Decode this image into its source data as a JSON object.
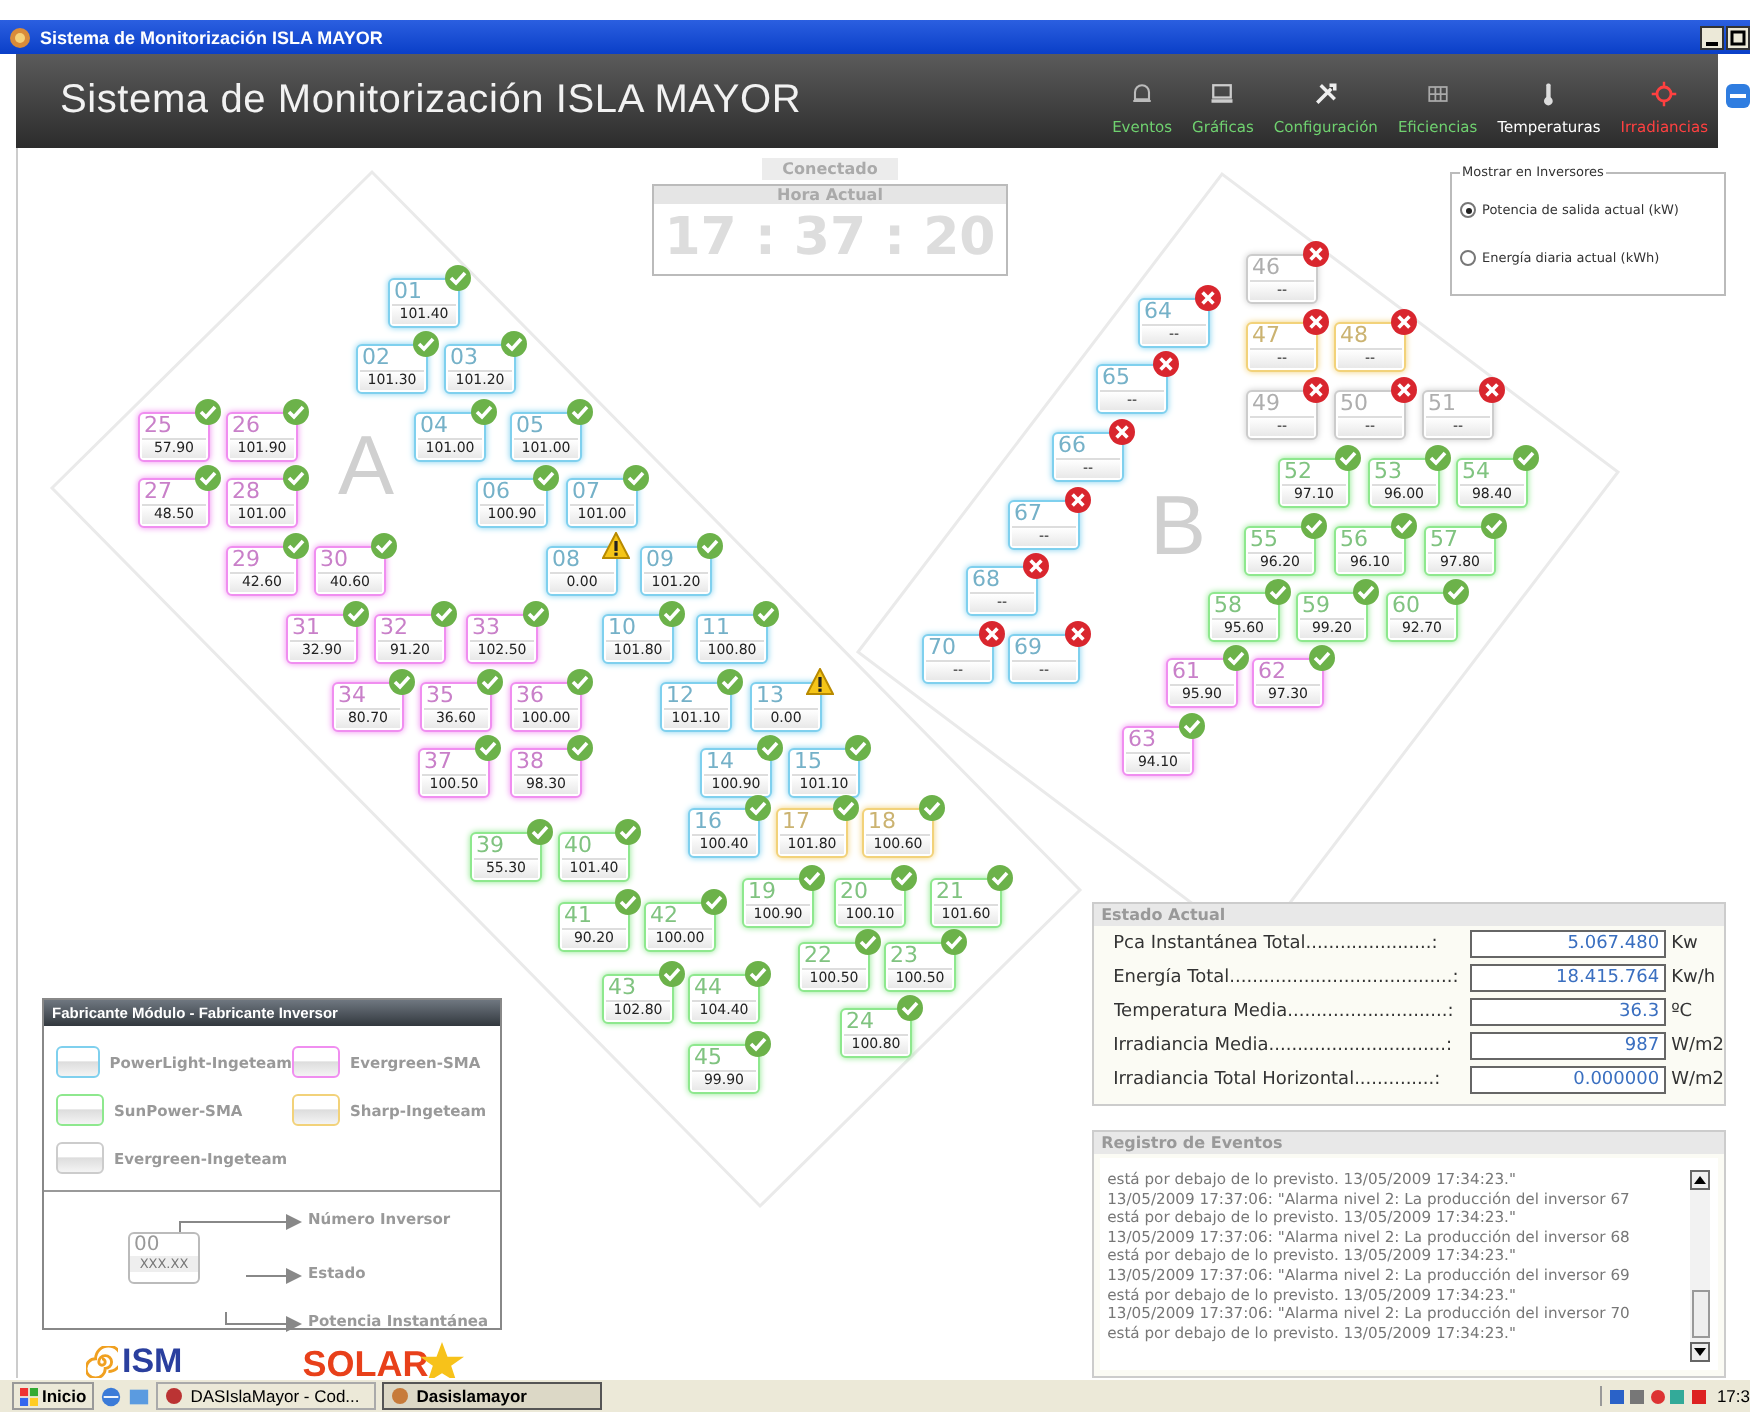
{
  "window": {
    "title": "Sistema de Monitorización ISLA MAYOR"
  },
  "header": {
    "title": "Sistema de Monitorización ISLA MAYOR",
    "nav": [
      {
        "label": "Eventos"
      },
      {
        "label": "Gráficas"
      },
      {
        "label": "Configuración"
      },
      {
        "label": "Eficiencias"
      },
      {
        "label": "Temperaturas"
      },
      {
        "label": "Irradiancias"
      }
    ]
  },
  "connection": {
    "status": "Conectado",
    "clock_label": "Hora Actual",
    "time": "17 : 37 : 20"
  },
  "display_options": {
    "title": "Mostrar en Inversores",
    "options": [
      {
        "label": "Potencia de salida actual (kW)",
        "selected": true
      },
      {
        "label": "Energía diaria actual (kWh)",
        "selected": false
      }
    ]
  },
  "areas": [
    {
      "label": "A"
    },
    {
      "label": "B"
    }
  ],
  "inverters": [
    {
      "number": "46",
      "value": "--",
      "color": "#cccccc",
      "kind": "error"
    },
    {
      "number": "01",
      "value": "101.40",
      "color": "#7fd0ee",
      "kind": "ok"
    },
    {
      "number": "64",
      "value": "--",
      "color": "#7fd0ee",
      "kind": "error"
    },
    {
      "number": "47",
      "value": "--",
      "color": "#f2d27a",
      "kind": "error"
    },
    {
      "number": "48",
      "value": "--",
      "color": "#f2d27a",
      "kind": "error"
    },
    {
      "number": "02",
      "value": "101.30",
      "color": "#7fd0ee",
      "kind": "ok"
    },
    {
      "number": "03",
      "value": "101.20",
      "color": "#7fd0ee",
      "kind": "ok"
    },
    {
      "number": "65",
      "value": "--",
      "color": "#7fd0ee",
      "kind": "error"
    },
    {
      "number": "49",
      "value": "--",
      "color": "#cccccc",
      "kind": "error"
    },
    {
      "number": "50",
      "value": "--",
      "color": "#cccccc",
      "kind": "error"
    },
    {
      "number": "51",
      "value": "--",
      "color": "#cccccc",
      "kind": "error"
    },
    {
      "number": "25",
      "value": "57.90",
      "color": "#f08ef0",
      "kind": "ok"
    },
    {
      "number": "26",
      "value": "101.90",
      "color": "#f08ef0",
      "kind": "ok"
    },
    {
      "number": "04",
      "value": "101.00",
      "color": "#7fd0ee",
      "kind": "ok"
    },
    {
      "number": "05",
      "value": "101.00",
      "color": "#7fd0ee",
      "kind": "ok"
    },
    {
      "number": "66",
      "value": "--",
      "color": "#7fd0ee",
      "kind": "error"
    },
    {
      "number": "52",
      "value": "97.10",
      "color": "#8ee88e",
      "kind": "ok"
    },
    {
      "number": "53",
      "value": "96.00",
      "color": "#8ee88e",
      "kind": "ok"
    },
    {
      "number": "54",
      "value": "98.40",
      "color": "#8ee88e",
      "kind": "ok"
    },
    {
      "number": "27",
      "value": "48.50",
      "color": "#f08ef0",
      "kind": "ok"
    },
    {
      "number": "28",
      "value": "101.00",
      "color": "#f08ef0",
      "kind": "ok"
    },
    {
      "number": "06",
      "value": "100.90",
      "color": "#7fd0ee",
      "kind": "ok"
    },
    {
      "number": "07",
      "value": "101.00",
      "color": "#7fd0ee",
      "kind": "ok"
    },
    {
      "number": "67",
      "value": "--",
      "color": "#7fd0ee",
      "kind": "error"
    },
    {
      "number": "55",
      "value": "96.20",
      "color": "#8ee88e",
      "kind": "ok"
    },
    {
      "number": "56",
      "value": "96.10",
      "color": "#8ee88e",
      "kind": "ok"
    },
    {
      "number": "57",
      "value": "97.80",
      "color": "#8ee88e",
      "kind": "ok"
    },
    {
      "number": "29",
      "value": "42.60",
      "color": "#f08ef0",
      "kind": "ok"
    },
    {
      "number": "30",
      "value": "40.60",
      "color": "#f08ef0",
      "kind": "ok"
    },
    {
      "number": "08",
      "value": "0.00",
      "color": "#7fd0ee",
      "kind": "warning"
    },
    {
      "number": "09",
      "value": "101.20",
      "color": "#7fd0ee",
      "kind": "ok"
    },
    {
      "number": "68",
      "value": "--",
      "color": "#7fd0ee",
      "kind": "error"
    },
    {
      "number": "58",
      "value": "95.60",
      "color": "#8ee88e",
      "kind": "ok"
    },
    {
      "number": "59",
      "value": "99.20",
      "color": "#8ee88e",
      "kind": "ok"
    },
    {
      "number": "60",
      "value": "92.70",
      "color": "#8ee88e",
      "kind": "ok"
    },
    {
      "number": "31",
      "value": "32.90",
      "color": "#f08ef0",
      "kind": "ok"
    },
    {
      "number": "32",
      "value": "91.20",
      "color": "#f08ef0",
      "kind": "ok"
    },
    {
      "number": "33",
      "value": "102.50",
      "color": "#f08ef0",
      "kind": "ok"
    },
    {
      "number": "10",
      "value": "101.80",
      "color": "#7fd0ee",
      "kind": "ok"
    },
    {
      "number": "11",
      "value": "100.80",
      "color": "#7fd0ee",
      "kind": "ok"
    },
    {
      "number": "70",
      "value": "--",
      "color": "#7fd0ee",
      "kind": "error"
    },
    {
      "number": "69",
      "value": "--",
      "color": "#7fd0ee",
      "kind": "error"
    },
    {
      "number": "61",
      "value": "95.90",
      "color": "#f08ef0",
      "kind": "ok"
    },
    {
      "number": "62",
      "value": "97.30",
      "color": "#f08ef0",
      "kind": "ok"
    },
    {
      "number": "34",
      "value": "80.70",
      "color": "#f08ef0",
      "kind": "ok"
    },
    {
      "number": "35",
      "value": "36.60",
      "color": "#f08ef0",
      "kind": "ok"
    },
    {
      "number": "36",
      "value": "100.00",
      "color": "#f08ef0",
      "kind": "ok"
    },
    {
      "number": "12",
      "value": "101.10",
      "color": "#7fd0ee",
      "kind": "ok"
    },
    {
      "number": "13",
      "value": "0.00",
      "color": "#7fd0ee",
      "kind": "warning"
    },
    {
      "number": "63",
      "value": "94.10",
      "color": "#f08ef0",
      "kind": "ok"
    },
    {
      "number": "37",
      "value": "100.50",
      "color": "#f08ef0",
      "kind": "ok"
    },
    {
      "number": "38",
      "value": "98.30",
      "color": "#f08ef0",
      "kind": "ok"
    },
    {
      "number": "14",
      "value": "100.90",
      "color": "#7fd0ee",
      "kind": "ok"
    },
    {
      "number": "15",
      "value": "101.10",
      "color": "#7fd0ee",
      "kind": "ok"
    },
    {
      "number": "16",
      "value": "100.40",
      "color": "#7fd0ee",
      "kind": "ok"
    },
    {
      "number": "17",
      "value": "101.80",
      "color": "#f2d27a",
      "kind": "ok"
    },
    {
      "number": "18",
      "value": "100.60",
      "color": "#f2d27a",
      "kind": "ok"
    },
    {
      "number": "39",
      "value": "55.30",
      "color": "#8ee88e",
      "kind": "ok"
    },
    {
      "number": "40",
      "value": "101.40",
      "color": "#8ee88e",
      "kind": "ok"
    },
    {
      "number": "19",
      "value": "100.90",
      "color": "#8ee88e",
      "kind": "ok"
    },
    {
      "number": "20",
      "value": "100.10",
      "color": "#8ee88e",
      "kind": "ok"
    },
    {
      "number": "21",
      "value": "101.60",
      "color": "#8ee88e",
      "kind": "ok"
    },
    {
      "number": "41",
      "value": "90.20",
      "color": "#8ee88e",
      "kind": "ok"
    },
    {
      "number": "42",
      "value": "100.00",
      "color": "#8ee88e",
      "kind": "ok"
    },
    {
      "number": "22",
      "value": "100.50",
      "color": "#8ee88e",
      "kind": "ok"
    },
    {
      "number": "23",
      "value": "100.50",
      "color": "#8ee88e",
      "kind": "ok"
    },
    {
      "number": "43",
      "value": "102.80",
      "color": "#8ee88e",
      "kind": "ok"
    },
    {
      "number": "44",
      "value": "104.40",
      "color": "#8ee88e",
      "kind": "ok"
    },
    {
      "number": "24",
      "value": "100.80",
      "color": "#8ee88e",
      "kind": "ok"
    },
    {
      "number": "45",
      "value": "99.90",
      "color": "#8ee88e",
      "kind": "ok"
    }
  ],
  "legend": {
    "title": "Fabricante Módulo - Fabricante Inversor",
    "manufacturers": [
      {
        "label": "PowerLight-Ingeteam",
        "color": "#7fd0ee"
      },
      {
        "label": "Evergreen-SMA",
        "color": "#f08ef0"
      },
      {
        "label": "SunPower-SMA",
        "color": "#8ee88e"
      },
      {
        "label": "Sharp-Ingeteam",
        "color": "#f2d27a"
      },
      {
        "label": "Evergreen-Ingeteam",
        "color": "#cccccc"
      }
    ],
    "key": {
      "number": "00",
      "value": "XXX.XX",
      "labels": [
        "Número Inversor",
        "Estado",
        "Potencia Instantánea"
      ]
    }
  },
  "logos": [
    "ISM",
    "SOLAR"
  ],
  "current_state": {
    "title": "Estado Actual",
    "rows": [
      {
        "label": "Pca Instantánea Total......................:",
        "value": "5.067.480",
        "unit": "Kw"
      },
      {
        "label": "Energía Total.......................................:",
        "value": "18.415.764",
        "unit": "Kw/h"
      },
      {
        "label": "Temperatura Media............................:",
        "value": "36.3",
        "unit": "ºC"
      },
      {
        "label": "Irradiancia Media...............................:",
        "value": "987",
        "unit": "W/m2"
      },
      {
        "label": "Irradiancia Total Horizontal..............:",
        "value": "0.000000",
        "unit": "W/m2"
      }
    ]
  },
  "event_log": {
    "title": "Registro de Eventos",
    "lines": [
      "está por debajo de lo previsto. 13/05/2009 17:34:23.\"",
      "13/05/2009 17:37:06: \"Alarma nivel 2: La producción del inversor 67",
      "está por debajo de lo previsto. 13/05/2009 17:34:23.\"",
      "13/05/2009 17:37:06: \"Alarma nivel 2: La producción del inversor 68",
      "está por debajo de lo previsto. 13/05/2009 17:34:23.\"",
      "13/05/2009 17:37:06: \"Alarma nivel 2: La producción del inversor 69",
      "está por debajo de lo previsto. 13/05/2009 17:34:23.\"",
      "13/05/2009 17:37:06: \"Alarma nivel 2: La producción del inversor 70",
      "está por debajo de lo previsto. 13/05/2009 17:34:23.\""
    ]
  },
  "taskbar": {
    "start": "Inicio",
    "tasks": [
      {
        "label": "DASIslaMayor - Cod...",
        "selected": false
      },
      {
        "label": "Dasislamayor",
        "selected": true
      }
    ],
    "clock": "17:3"
  }
}
